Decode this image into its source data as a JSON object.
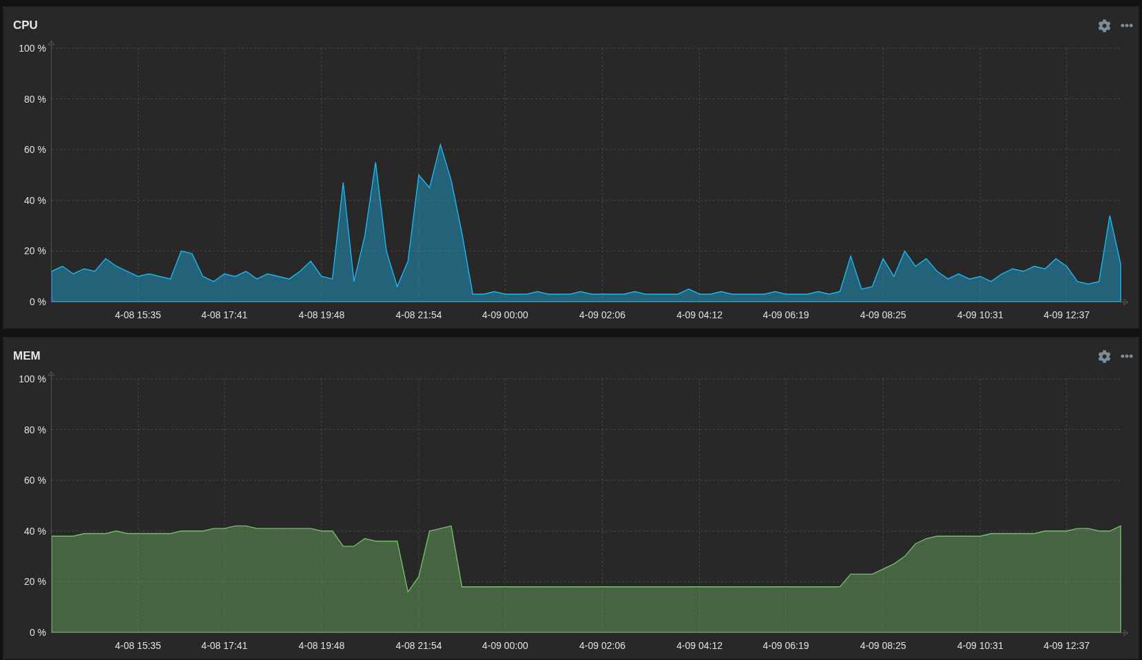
{
  "panels": [
    {
      "title": "CPU",
      "chart_data": {
        "type": "area",
        "grid": true,
        "ylim": [
          0,
          100
        ],
        "yticks": [
          {
            "value": 0,
            "label": "0 %"
          },
          {
            "value": 20,
            "label": "20 %"
          },
          {
            "value": 40,
            "label": "40 %"
          },
          {
            "value": 60,
            "label": "60 %"
          },
          {
            "value": 80,
            "label": "80 %"
          },
          {
            "value": 100,
            "label": "100 %"
          }
        ],
        "categories": [
          null,
          null,
          null,
          null,
          null,
          null,
          null,
          null,
          "4-08 15:35",
          null,
          null,
          null,
          null,
          null,
          null,
          null,
          "4-08 17:41",
          null,
          null,
          null,
          null,
          null,
          null,
          null,
          null,
          "4-08 19:48",
          null,
          null,
          null,
          null,
          null,
          null,
          null,
          null,
          "4-08 21:54",
          null,
          null,
          null,
          null,
          null,
          null,
          null,
          "4-09 00:00",
          null,
          null,
          null,
          null,
          null,
          null,
          null,
          null,
          "4-09 02:06",
          null,
          null,
          null,
          null,
          null,
          null,
          null,
          null,
          "4-09 04:12",
          null,
          null,
          null,
          null,
          null,
          null,
          null,
          "4-09 06:19",
          null,
          null,
          null,
          null,
          null,
          null,
          null,
          null,
          "4-09 08:25",
          null,
          null,
          null,
          null,
          null,
          null,
          null,
          null,
          "4-09 10:31",
          null,
          null,
          null,
          null,
          null,
          null,
          null,
          "4-09 12:37",
          null,
          null,
          null,
          null,
          null
        ],
        "series": [
          {
            "color": "#1cb8f0",
            "values": [
              12,
              14,
              11,
              13,
              12,
              17,
              14,
              12,
              10,
              11,
              10,
              9,
              20,
              19,
              10,
              8,
              11,
              10,
              12,
              9,
              11,
              10,
              9,
              12,
              16,
              10,
              9,
              47,
              8,
              26,
              55,
              20,
              6,
              16,
              50,
              45,
              62,
              48,
              27,
              3,
              3,
              4,
              3,
              3,
              3,
              4,
              3,
              3,
              3,
              4,
              3,
              3,
              3,
              3,
              4,
              3,
              3,
              3,
              3,
              5,
              3,
              3,
              4,
              3,
              3,
              3,
              3,
              4,
              3,
              3,
              3,
              4,
              3,
              4,
              18,
              5,
              6,
              17,
              10,
              20,
              14,
              17,
              12,
              9,
              11,
              9,
              10,
              8,
              11,
              13,
              12,
              14,
              13,
              17,
              14,
              8,
              7,
              8,
              34,
              15
            ]
          }
        ]
      }
    },
    {
      "title": "MEM",
      "chart_data": {
        "type": "area",
        "grid": true,
        "ylim": [
          0,
          100
        ],
        "yticks": [
          {
            "value": 0,
            "label": "0 %"
          },
          {
            "value": 20,
            "label": "20 %"
          },
          {
            "value": 40,
            "label": "40 %"
          },
          {
            "value": 60,
            "label": "60 %"
          },
          {
            "value": 80,
            "label": "80 %"
          },
          {
            "value": 100,
            "label": "100 %"
          }
        ],
        "categories": [
          null,
          null,
          null,
          null,
          null,
          null,
          null,
          null,
          "4-08 15:35",
          null,
          null,
          null,
          null,
          null,
          null,
          null,
          "4-08 17:41",
          null,
          null,
          null,
          null,
          null,
          null,
          null,
          null,
          "4-08 19:48",
          null,
          null,
          null,
          null,
          null,
          null,
          null,
          null,
          "4-08 21:54",
          null,
          null,
          null,
          null,
          null,
          null,
          null,
          "4-09 00:00",
          null,
          null,
          null,
          null,
          null,
          null,
          null,
          null,
          "4-09 02:06",
          null,
          null,
          null,
          null,
          null,
          null,
          null,
          null,
          "4-09 04:12",
          null,
          null,
          null,
          null,
          null,
          null,
          null,
          "4-09 06:19",
          null,
          null,
          null,
          null,
          null,
          null,
          null,
          null,
          "4-09 08:25",
          null,
          null,
          null,
          null,
          null,
          null,
          null,
          null,
          "4-09 10:31",
          null,
          null,
          null,
          null,
          null,
          null,
          null,
          "4-09 12:37",
          null,
          null,
          null,
          null,
          null
        ],
        "series": [
          {
            "color": "#73bf69",
            "values": [
              38,
              38,
              38,
              39,
              39,
              39,
              40,
              39,
              39,
              39,
              39,
              39,
              40,
              40,
              40,
              41,
              41,
              42,
              42,
              41,
              41,
              41,
              41,
              41,
              41,
              40,
              40,
              34,
              34,
              37,
              36,
              36,
              36,
              16,
              22,
              40,
              41,
              42,
              18,
              18,
              18,
              18,
              18,
              18,
              18,
              18,
              18,
              18,
              18,
              18,
              18,
              18,
              18,
              18,
              18,
              18,
              18,
              18,
              18,
              18,
              18,
              18,
              18,
              18,
              18,
              18,
              18,
              18,
              18,
              18,
              18,
              18,
              18,
              18,
              23,
              23,
              23,
              25,
              27,
              30,
              35,
              37,
              38,
              38,
              38,
              38,
              38,
              39,
              39,
              39,
              39,
              39,
              40,
              40,
              40,
              41,
              41,
              40,
              40,
              42
            ]
          }
        ]
      }
    }
  ]
}
